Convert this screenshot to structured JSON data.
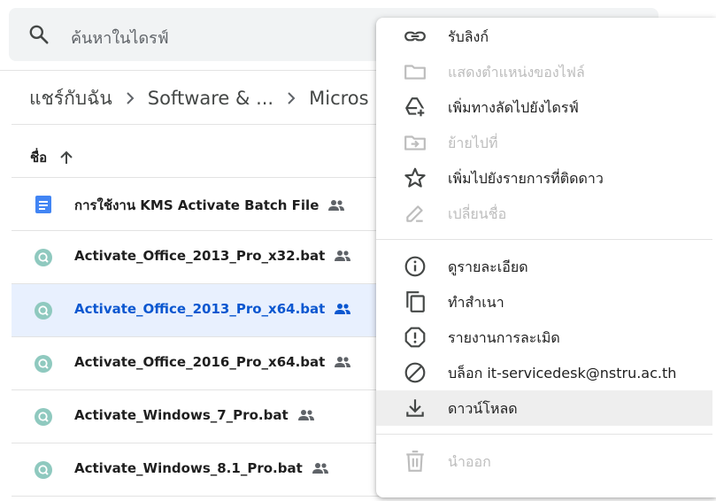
{
  "search": {
    "placeholder": "ค้นหาในไดรฟ์",
    "icon": "search-icon"
  },
  "breadcrumb": [
    {
      "label": "แชร์กับฉัน"
    },
    {
      "label": "Software & ..."
    },
    {
      "label": "Micros"
    }
  ],
  "file_list": {
    "column_header": "ชื่อ",
    "sort_icon": "arrow-up-icon",
    "files": [
      {
        "name": "การใช้งาน KMS Activate Batch File",
        "type": "document",
        "shared": true,
        "selected": false
      },
      {
        "name": "Activate_Office_2013_Pro_x32.bat",
        "type": "bat",
        "shared": true,
        "selected": false
      },
      {
        "name": "Activate_Office_2013_Pro_x64.bat",
        "type": "bat",
        "shared": true,
        "selected": true
      },
      {
        "name": "Activate_Office_2016_Pro_x64.bat",
        "type": "bat",
        "shared": true,
        "selected": false
      },
      {
        "name": "Activate_Windows_7_Pro.bat",
        "type": "bat",
        "shared": true,
        "selected": false
      },
      {
        "name": "Activate_Windows_8.1_Pro.bat",
        "type": "bat",
        "shared": true,
        "selected": false
      }
    ]
  },
  "context_menu": {
    "items": [
      {
        "label": "รับลิงก์",
        "icon": "link-icon",
        "enabled": true
      },
      {
        "label": "แสดงตำแหน่งของไฟล์",
        "icon": "folder-icon",
        "enabled": false
      },
      {
        "label": "เพิ่มทางลัดไปยังไดรฟ์",
        "icon": "add-shortcut-icon",
        "enabled": true
      },
      {
        "label": "ย้ายไปที่",
        "icon": "move-to-icon",
        "enabled": false
      },
      {
        "label": "เพิ่มไปยังรายการที่ติดดาว",
        "icon": "star-icon",
        "enabled": true
      },
      {
        "label": "เปลี่ยนชื่อ",
        "icon": "pencil-icon",
        "enabled": false
      },
      {
        "label": "ดูรายละเอียด",
        "icon": "info-icon",
        "enabled": true
      },
      {
        "label": "ทำสำเนา",
        "icon": "copy-icon",
        "enabled": true
      },
      {
        "label": "รายงานการละเมิด",
        "icon": "report-icon",
        "enabled": true
      },
      {
        "label": "บล็อก it-servicedesk@nstru.ac.th",
        "icon": "block-icon",
        "enabled": true
      },
      {
        "label": "ดาวน์โหลด",
        "icon": "download-icon",
        "enabled": true,
        "hovered": true
      },
      {
        "label": "นำออก",
        "icon": "trash-icon",
        "enabled": false
      }
    ]
  },
  "colors": {
    "selected_row_bg": "#e8f0fe",
    "selected_text": "#0b57d0",
    "doc_icon": "#4285f4",
    "bat_icon": "#5fb6a6",
    "disabled": "#bdbdbd"
  }
}
